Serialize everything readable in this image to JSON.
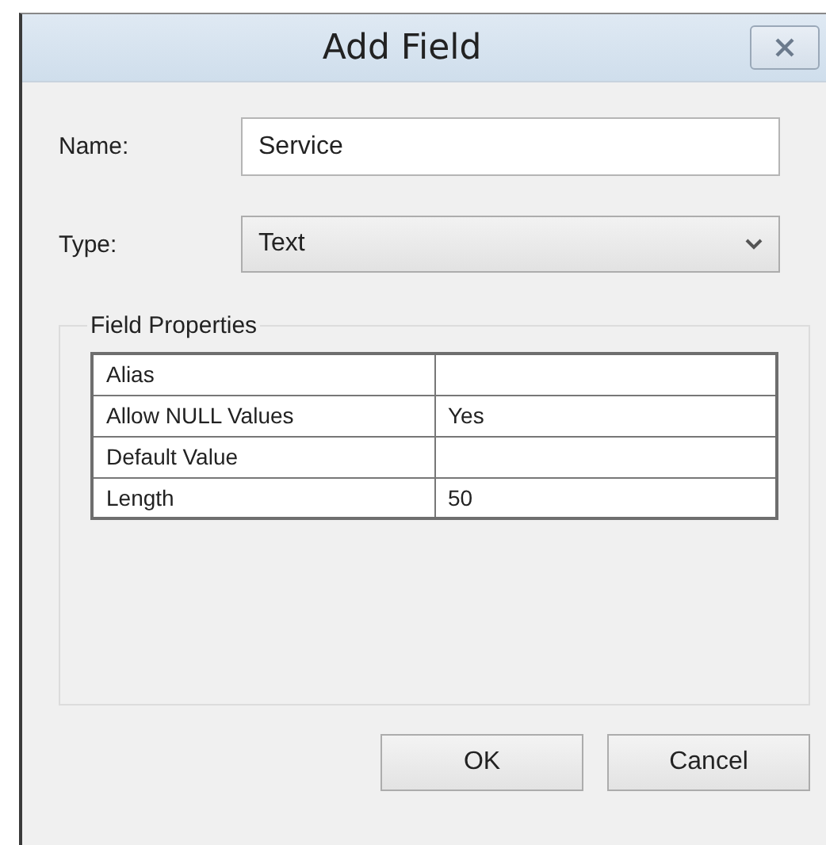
{
  "window": {
    "title": "Add Field"
  },
  "name_field": {
    "label": "Name:",
    "value": "Service"
  },
  "type_field": {
    "label": "Type:",
    "value": "Text"
  },
  "field_properties": {
    "title": "Field Properties",
    "rows": [
      {
        "property": "Alias",
        "value": ""
      },
      {
        "property": "Allow NULL Values",
        "value": "Yes"
      },
      {
        "property": "Default Value",
        "value": ""
      },
      {
        "property": "Length",
        "value": "50"
      }
    ]
  },
  "buttons": [
    "OK",
    "Cancel"
  ]
}
